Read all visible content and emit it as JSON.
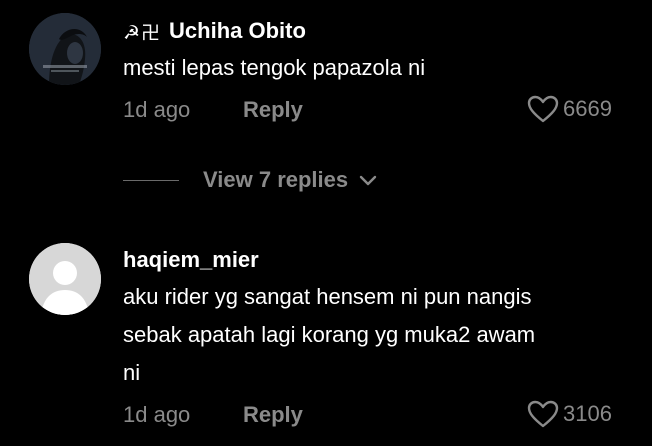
{
  "comments": [
    {
      "username_prefix": "☭卍",
      "username": "Uchiha Obito",
      "text": "mesti lepas tengok papazola ni",
      "time": "1d ago",
      "reply_label": "Reply",
      "likes": "6669",
      "avatar": "profile-photo"
    },
    {
      "username_prefix": "",
      "username": "haqiem_mier",
      "text": "aku rider yg sangat hensem ni pun nangis sebak apatah lagi korang yg muka2 awam ni",
      "time": "1d ago",
      "reply_label": "Reply",
      "likes": "3106",
      "avatar": "default-avatar"
    }
  ],
  "view_replies": {
    "label": "View 7 replies"
  },
  "colors": {
    "background": "#000000",
    "text": "#ffffff",
    "secondary_text": "#8a8a8a",
    "default_avatar": "#d7d7d7"
  }
}
